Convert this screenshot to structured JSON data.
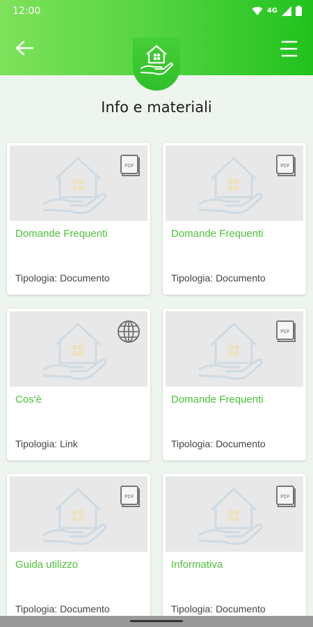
{
  "status_bar": {
    "time": "12:00",
    "network": "4G"
  },
  "header": {
    "title": "Info e materiali"
  },
  "cards": [
    {
      "title": "Domande Frequenti",
      "meta": "Tipologia: Documento",
      "type_icon": "pdf-icon"
    },
    {
      "title": "Domande Frequenti",
      "meta": "Tipologia: Documento",
      "type_icon": "pdf-icon"
    },
    {
      "title": "Cos'è",
      "meta": "Tipologia: Link",
      "type_icon": "globe-icon"
    },
    {
      "title": "Domande Frequenti",
      "meta": "Tipologia: Documento",
      "type_icon": "pdf-icon"
    },
    {
      "title": "Guida utilizzo",
      "meta": "Tipologia: Documento",
      "type_icon": "pdf-icon"
    },
    {
      "title": "Informativa",
      "meta": "Tipologia: Documento",
      "type_icon": "pdf-icon"
    }
  ],
  "pdf_label": "PDF",
  "colors": {
    "accent": "#4cc13a",
    "header_start": "#7ee25a",
    "header_end": "#21c21d"
  }
}
